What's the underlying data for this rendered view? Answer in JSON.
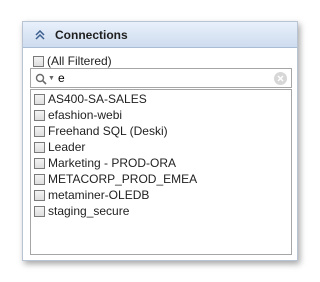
{
  "panel": {
    "title": "Connections",
    "collapse_icon": "double-chevron-up-icon"
  },
  "filter": {
    "all_label": "(All Filtered)"
  },
  "search": {
    "value": "e",
    "icon": "search-icon",
    "clear_icon": "clear-icon"
  },
  "connections": [
    "AS400-SA-SALES",
    "efashion-webi",
    "Freehand SQL (Deski)",
    "Leader",
    "Marketing - PROD-ORA",
    "METACORP_PROD_EMEA",
    "metaminer-OLEDB",
    "staging_secure"
  ],
  "colors": {
    "header_start": "#e8f0fb",
    "header_end": "#cfdcef",
    "border": "#b8c4d4",
    "icon": "#3b5f8f"
  }
}
